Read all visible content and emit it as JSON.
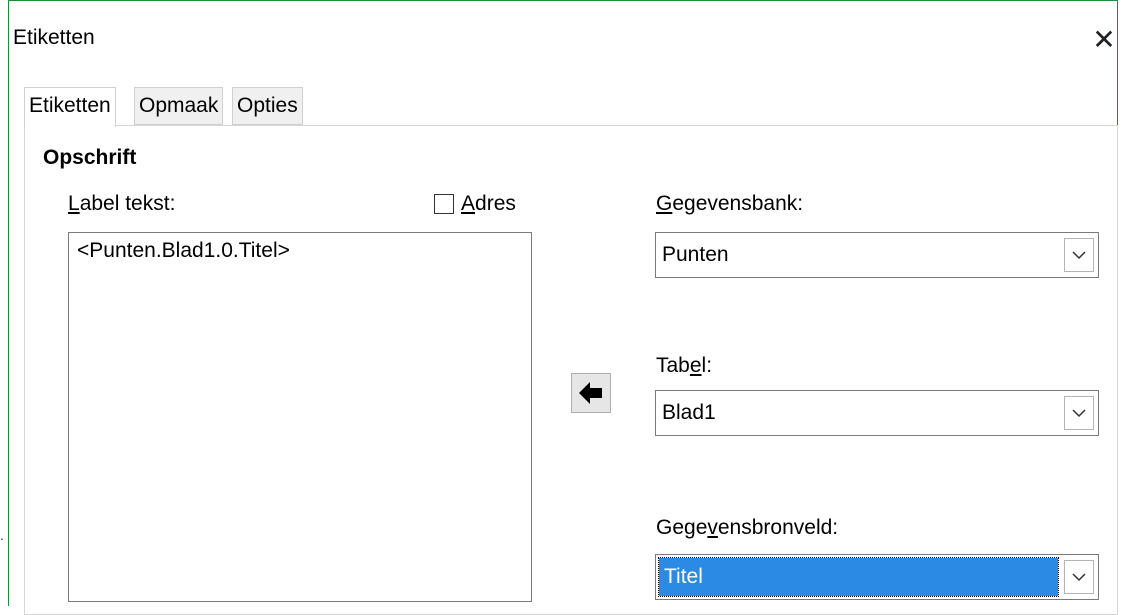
{
  "window": {
    "title": "Etiketten"
  },
  "tabs": [
    {
      "label": "Etiketten"
    },
    {
      "label": "Opmaak"
    },
    {
      "label": "Opties"
    }
  ],
  "section": {
    "heading": "Opschrift"
  },
  "label_text": {
    "label_mnemonic": "L",
    "label_rest": "abel tekst:",
    "content": "<Punten.Blad1.0.Titel>"
  },
  "address": {
    "mnemonic": "A",
    "rest": "dres",
    "checked": false
  },
  "database": {
    "label_mnemonic": "G",
    "label_rest": "egevensbank:",
    "value": "Punten"
  },
  "table": {
    "label_pre": "Tab",
    "label_mnemonic": "e",
    "label_rest": "l:",
    "value": "Blad1"
  },
  "source_field": {
    "label_pre": "Gege",
    "label_mnemonic": "v",
    "label_rest": "ensbronveld:",
    "value": "Titel"
  },
  "icons": {
    "close": "close-icon",
    "insert": "arrow-left-icon",
    "dropdown": "chevron-down-icon"
  },
  "colors": {
    "selection": "#2a8ae4",
    "window_border": "#1a8f3a"
  }
}
